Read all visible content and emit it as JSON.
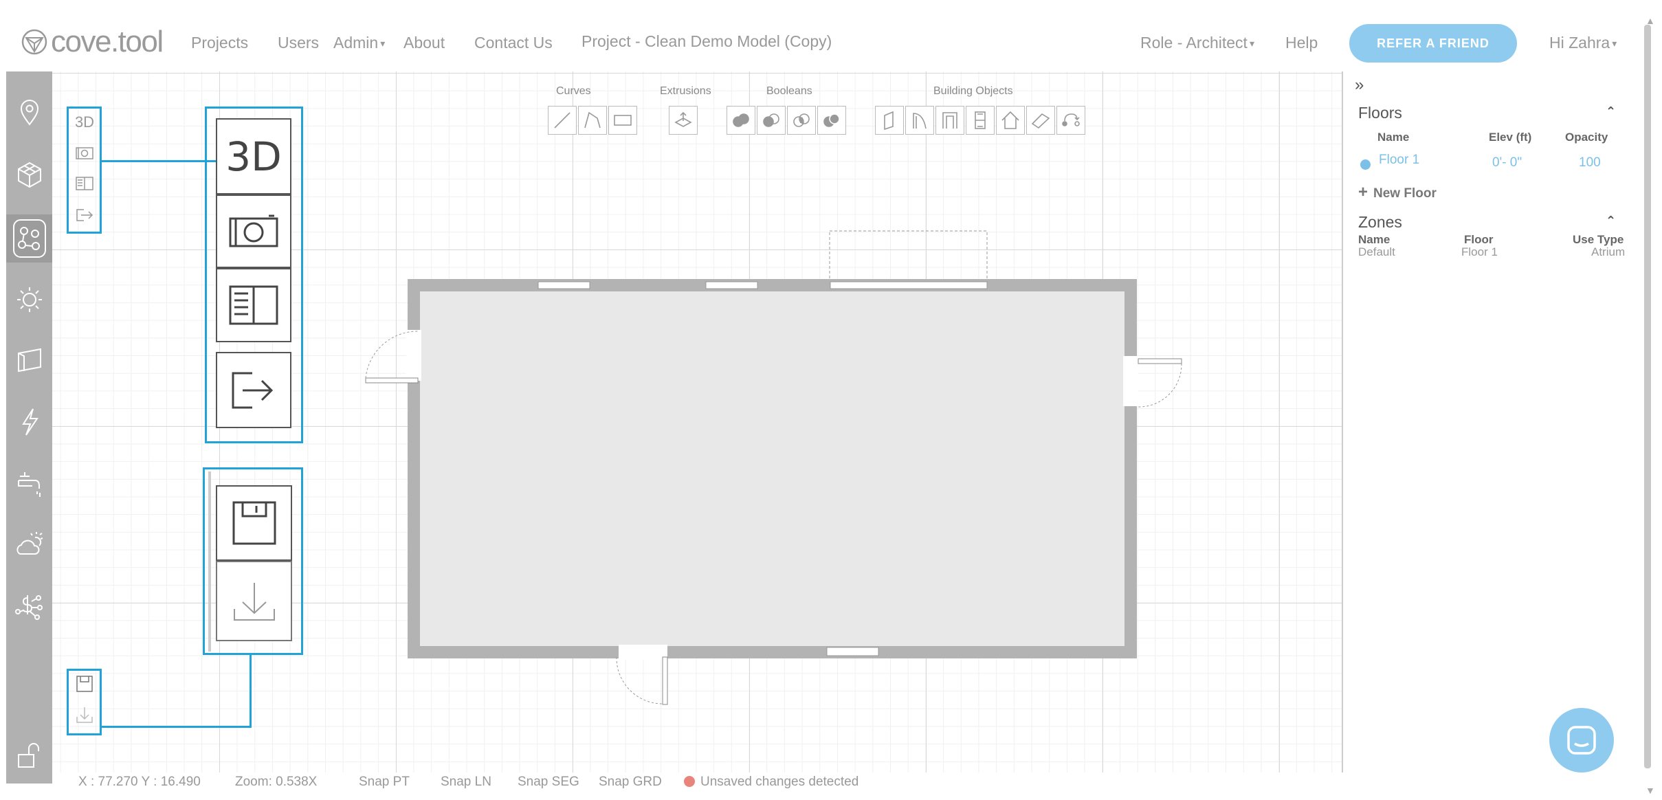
{
  "app": {
    "logo_text": "cove.tool",
    "nav": {
      "projects": "Projects",
      "users": "Users",
      "admin": "Admin",
      "about": "About",
      "contact": "Contact Us",
      "project_title": "Project - Clean Demo Model (Copy)",
      "role": "Role - Architect",
      "help": "Help",
      "refer": "REFER A FRIEND",
      "greeting": "Hi Zahra"
    }
  },
  "sidebar": {
    "items": [
      {
        "icon": "location-pin-icon"
      },
      {
        "icon": "cube-icon"
      },
      {
        "icon": "analysis-nodes-icon",
        "active": true
      },
      {
        "icon": "sun-icon"
      },
      {
        "icon": "surface-icon"
      },
      {
        "icon": "lightning-icon"
      },
      {
        "icon": "faucet-icon"
      },
      {
        "icon": "cloud-sun-icon"
      },
      {
        "icon": "cost-network-icon"
      },
      {
        "icon": "unlock-icon"
      }
    ]
  },
  "toolbar": {
    "groups": [
      {
        "label": "Curves",
        "tools": [
          "line-tool-icon",
          "polyline-tool-icon",
          "rectangle-tool-icon"
        ]
      },
      {
        "label": "Extrusions",
        "tools": [
          "extrude-tool-icon"
        ]
      },
      {
        "label": "Booleans",
        "tools": [
          "union-icon",
          "subtract-icon",
          "intersect-icon",
          "split-icon"
        ]
      },
      {
        "label": "Building Objects",
        "tools": [
          "wall-icon",
          "door-icon",
          "opening-icon",
          "window-icon",
          "roof-icon",
          "shade-icon",
          "stair-icon"
        ]
      }
    ]
  },
  "view_tools": {
    "threed_label": "3D",
    "callout_threed": "3D"
  },
  "status_bar": {
    "coords": "X : 77.270  Y : 16.490",
    "zoom": "Zoom: 0.538X",
    "snap_pt": "Snap PT",
    "snap_ln": "Snap LN",
    "snap_seg": "Snap SEG",
    "snap_grd": "Snap GRD",
    "unsaved": "Unsaved changes detected"
  },
  "right_panel": {
    "collapse": "»",
    "floors": {
      "title": "Floors",
      "col_name": "Name",
      "col_elev": "Elev (ft)",
      "col_opacity": "Opacity",
      "rows": [
        {
          "name": "Floor 1",
          "elev": "0'- 0\"",
          "opacity": "100"
        }
      ],
      "new_floor": "New Floor"
    },
    "zones": {
      "title": "Zones",
      "col_name": "Name",
      "col_floor": "Floor",
      "col_use": "Use Type",
      "rows": [
        {
          "name": "Default",
          "floor": "Floor 1",
          "use": "Atrium"
        }
      ]
    }
  },
  "colors": {
    "accent": "#8fcbee",
    "highlight": "#1fa3d8",
    "sidebar": "#b1b1b1",
    "wall": "#b3b3b3",
    "floor_fill": "#e8e8e8",
    "unsaved_dot": "#e9847a"
  }
}
